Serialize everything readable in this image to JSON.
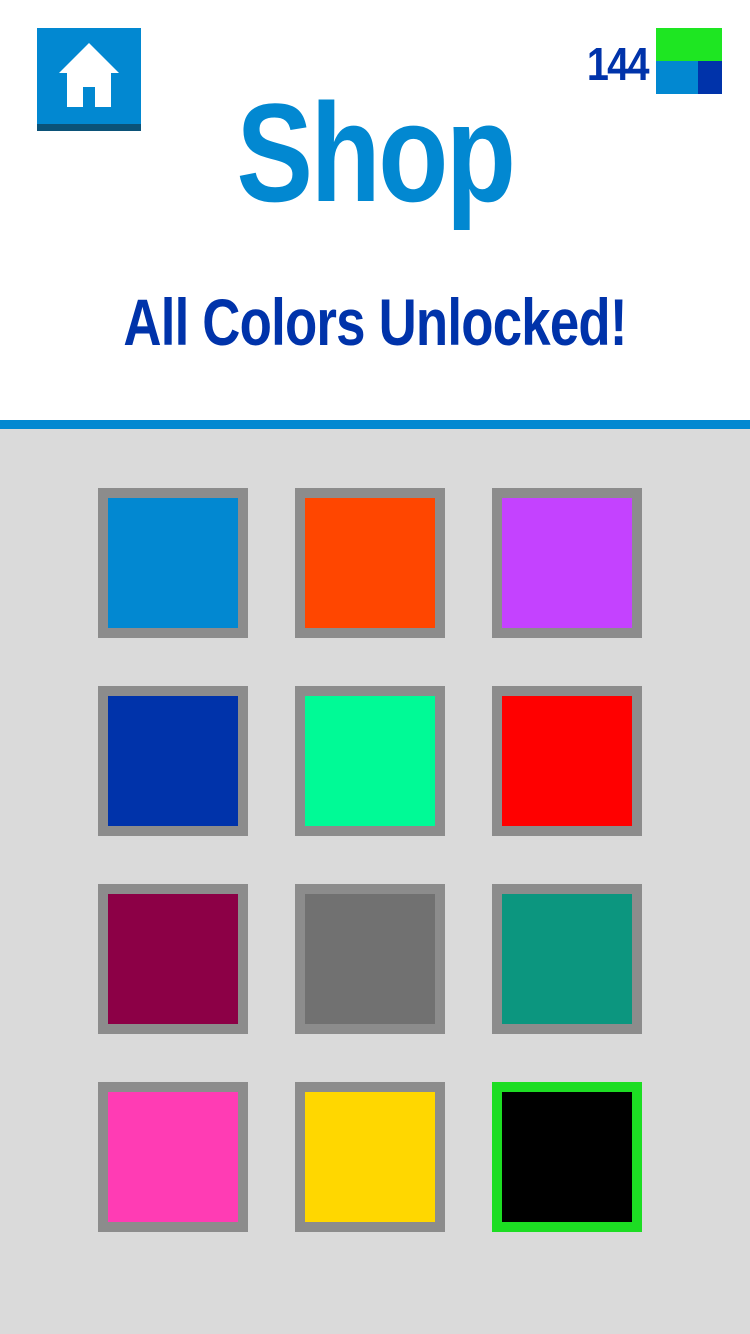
{
  "header": {
    "title": "Shop",
    "status": "All Colors Unlocked!",
    "coins": "144",
    "coin_icon": {
      "colors": [
        "#1ee622",
        "#0288d1",
        "#0033aa"
      ]
    }
  },
  "home_button": {
    "icon": "home-icon",
    "color": "#0288d1"
  },
  "colors": [
    {
      "name": "blue",
      "hex": "#0288d1",
      "selected": false
    },
    {
      "name": "orange",
      "hex": "#ff4600",
      "selected": false
    },
    {
      "name": "purple",
      "hex": "#c442ff",
      "selected": false
    },
    {
      "name": "navy",
      "hex": "#0033aa",
      "selected": false
    },
    {
      "name": "mint",
      "hex": "#00fa96",
      "selected": false
    },
    {
      "name": "red",
      "hex": "#ff0000",
      "selected": false
    },
    {
      "name": "maroon",
      "hex": "#8c0046",
      "selected": false
    },
    {
      "name": "gray",
      "hex": "#717171",
      "selected": false
    },
    {
      "name": "teal",
      "hex": "#0c967f",
      "selected": false
    },
    {
      "name": "pink",
      "hex": "#ff3cb4",
      "selected": false
    },
    {
      "name": "yellow",
      "hex": "#ffd700",
      "selected": false
    },
    {
      "name": "black",
      "hex": "#000000",
      "selected": true
    }
  ]
}
